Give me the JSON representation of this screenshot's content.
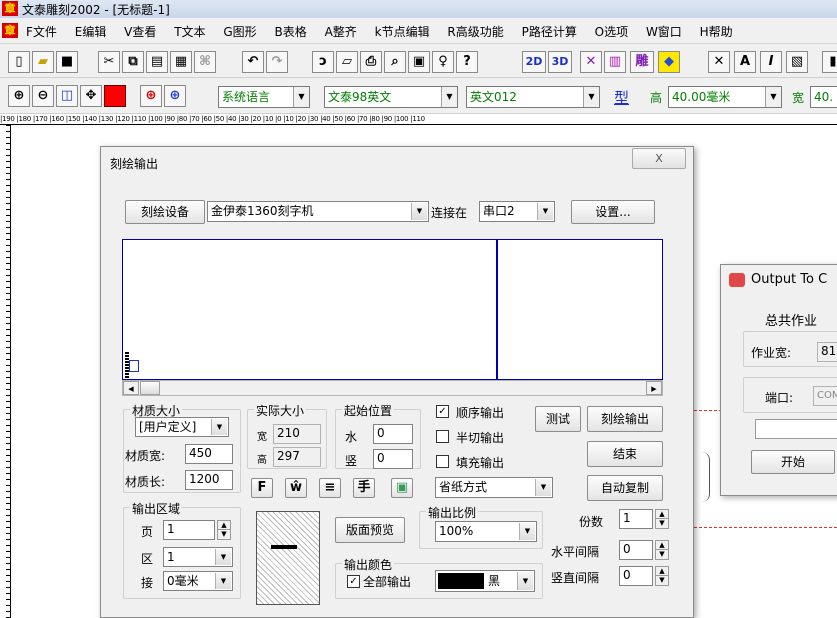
{
  "window": {
    "title": "文泰雕刻2002 - [无标题-1]",
    "app_icon": "章"
  },
  "menu": [
    "F文件",
    "E编辑",
    "V查看",
    "T文本",
    "G图形",
    "B表格",
    "A整齐",
    "k节点编辑",
    "R高级功能",
    "P路径计算",
    "O选项",
    "W窗口",
    "H帮助"
  ],
  "toolbar1": {
    "mode_2d": "2D",
    "mode_3d": "3D",
    "carve_label": "雕"
  },
  "toolbar2": {
    "language": "系统语言",
    "font_cn": "文泰98英文",
    "font_en": "英文012",
    "type_label": "型",
    "height_label": "高",
    "height_value": "40.00毫米",
    "width_label": "宽",
    "width_value": "40."
  },
  "ruler_text": "|190 |180 |170 |160 |150 |140 |130 |120 |110 |100 |90 |80 |70 |60 |50 |40 |30 |20 |10 |0 |10 |20 |30 |40 |50 |60 |70 |80 |90 |100 |110",
  "dialog": {
    "title": "刻绘输出",
    "close_label": "X",
    "device_button": "刻绘设备",
    "device_value": "金伊泰1360刻字机",
    "connect_label": "连接在",
    "port_value": "串口2",
    "settings_button": "设置...",
    "material_group": "材质大小",
    "material_preset": "[用户定义]",
    "material_width_label": "材质宽:",
    "material_width": "450",
    "material_length_label": "材质长:",
    "material_length": "1200",
    "actual_group": "实际大小",
    "actual_w_label": "宽",
    "actual_w": "210",
    "actual_h_label": "高",
    "actual_h": "297",
    "start_group": "起始位置",
    "start_h_label": "水",
    "start_h": "0",
    "start_v_label": "竖",
    "start_v": "0",
    "seq_output": "顺序输出",
    "half_cut": "半切输出",
    "fill_output": "填充输出",
    "paper_mode": "省纸方式",
    "test_button": "测试",
    "carve_button": "刻绘输出",
    "end_button": "结束",
    "auto_copy_button": "自动复制",
    "output_area_group": "输出区域",
    "page_label": "页",
    "page_value": "1",
    "zone_label": "区",
    "zone_value": "1",
    "join_label": "接",
    "join_value": "0毫米",
    "preview_button": "版面预览",
    "scale_group": "输出比例",
    "scale_value": "100%",
    "color_group": "输出颜色",
    "all_output": "全部输出",
    "color_name": "黑",
    "copies_label": "份数",
    "copies_value": "1",
    "h_gap_label": "水平间隔",
    "h_gap_value": "0",
    "v_gap_label": "竖直间隔",
    "v_gap_value": "0",
    "icon_buttons": [
      "F",
      "ŵ",
      "≡",
      "手",
      "▣"
    ]
  },
  "dialog2": {
    "title": "Output To C",
    "total_job": "总共作业",
    "job_width_label": "作业宽:",
    "job_width": "81",
    "port_label": "端口:",
    "port_value": "COM",
    "start_button": "开始"
  },
  "colors": {
    "preview_border": "#0000b0",
    "accent_red": "#d80000",
    "black_swatch": "#000000"
  }
}
